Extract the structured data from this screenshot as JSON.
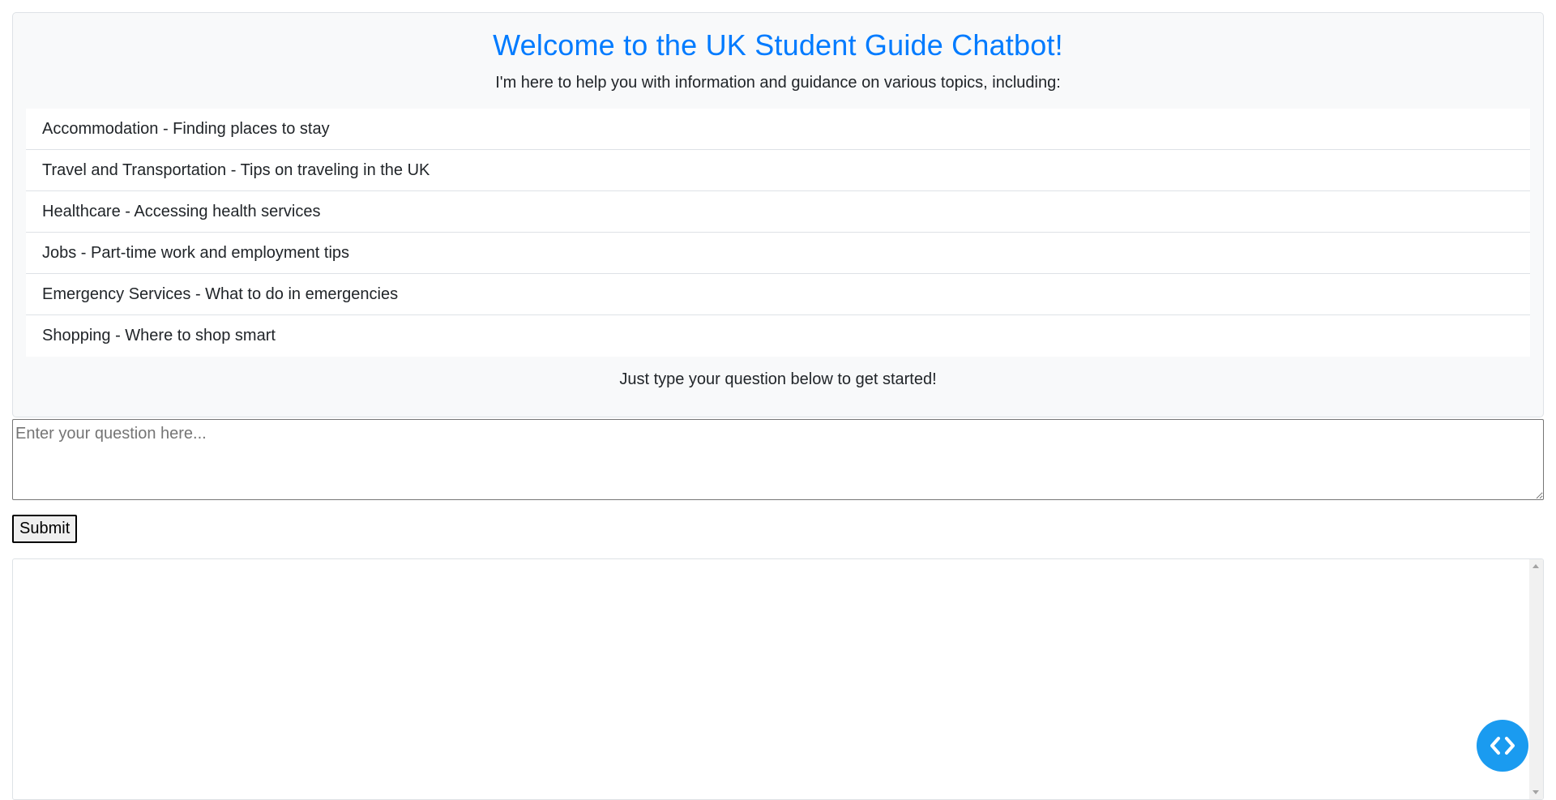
{
  "welcome": {
    "title": "Welcome to the UK Student Guide Chatbot!",
    "subtitle": "I'm here to help you with information and guidance on various topics, including:",
    "topics": [
      "Accommodation - Finding places to stay",
      "Travel and Transportation - Tips on traveling in the UK",
      "Healthcare - Accessing health services",
      "Jobs - Part-time work and employment tips",
      "Emergency Services - What to do in emergencies",
      "Shopping - Where to shop smart"
    ],
    "footer": "Just type your question below to get started!"
  },
  "form": {
    "question_placeholder": "Enter your question here...",
    "question_value": "",
    "submit_label": "Submit"
  },
  "response": {
    "text": ""
  },
  "fab": {
    "icon": "code-brackets-icon"
  },
  "colors": {
    "accent": "#007bff",
    "panel_background": "#f8f9fa",
    "fab": "#1a9bf0"
  }
}
